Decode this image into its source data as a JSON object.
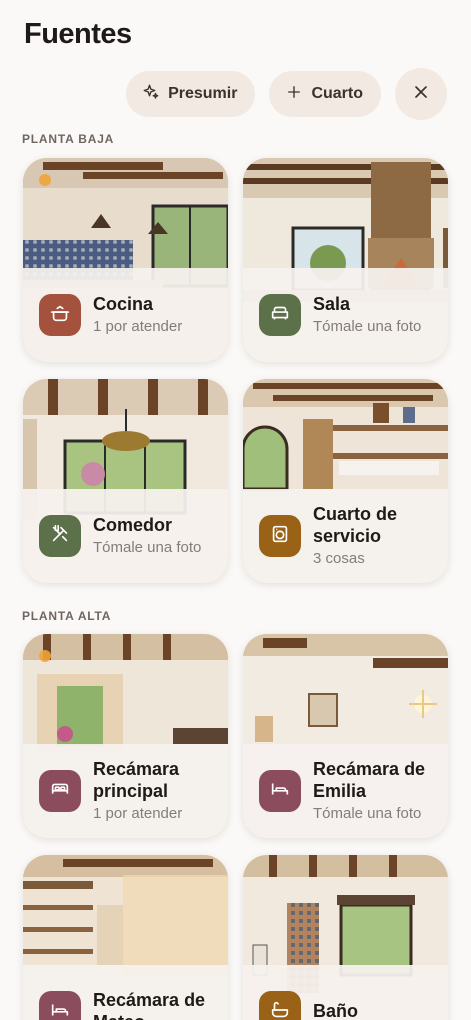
{
  "header": {
    "title": "Fuentes"
  },
  "toolbar": {
    "presumir_label": "Presumir",
    "cuarto_label": "Cuarto"
  },
  "sections": {
    "planta_baja": "PLANTA BAJA",
    "planta_alta": "PLANTA ALTA"
  },
  "rooms": [
    {
      "name": "Cocina",
      "sub": "1 por atender",
      "icon": "pot-icon",
      "color": "#a4523d"
    },
    {
      "name": "Sala",
      "sub": "Tómale una foto",
      "icon": "sofa-icon",
      "color": "#5c7049"
    },
    {
      "name": "Comedor",
      "sub": "Tómale una foto",
      "icon": "utensils-icon",
      "color": "#5c7049"
    },
    {
      "name": "Cuarto de servicio",
      "sub": "3 cosas",
      "icon": "washer-icon",
      "color": "#9a6217"
    },
    {
      "name": "Recámara principal",
      "sub": "1 por atender",
      "icon": "bed-icon",
      "color": "#8b4d5d"
    },
    {
      "name": "Recámara de Emilia",
      "sub": "Tómale una foto",
      "icon": "bed-icon",
      "color": "#8b4d5d"
    },
    {
      "name": "Recámara de Mateo",
      "sub": "",
      "icon": "bed-icon",
      "color": "#8b4d5d"
    },
    {
      "name": "Baño",
      "sub": "",
      "icon": "bath-icon",
      "color": "#9a6217"
    }
  ]
}
